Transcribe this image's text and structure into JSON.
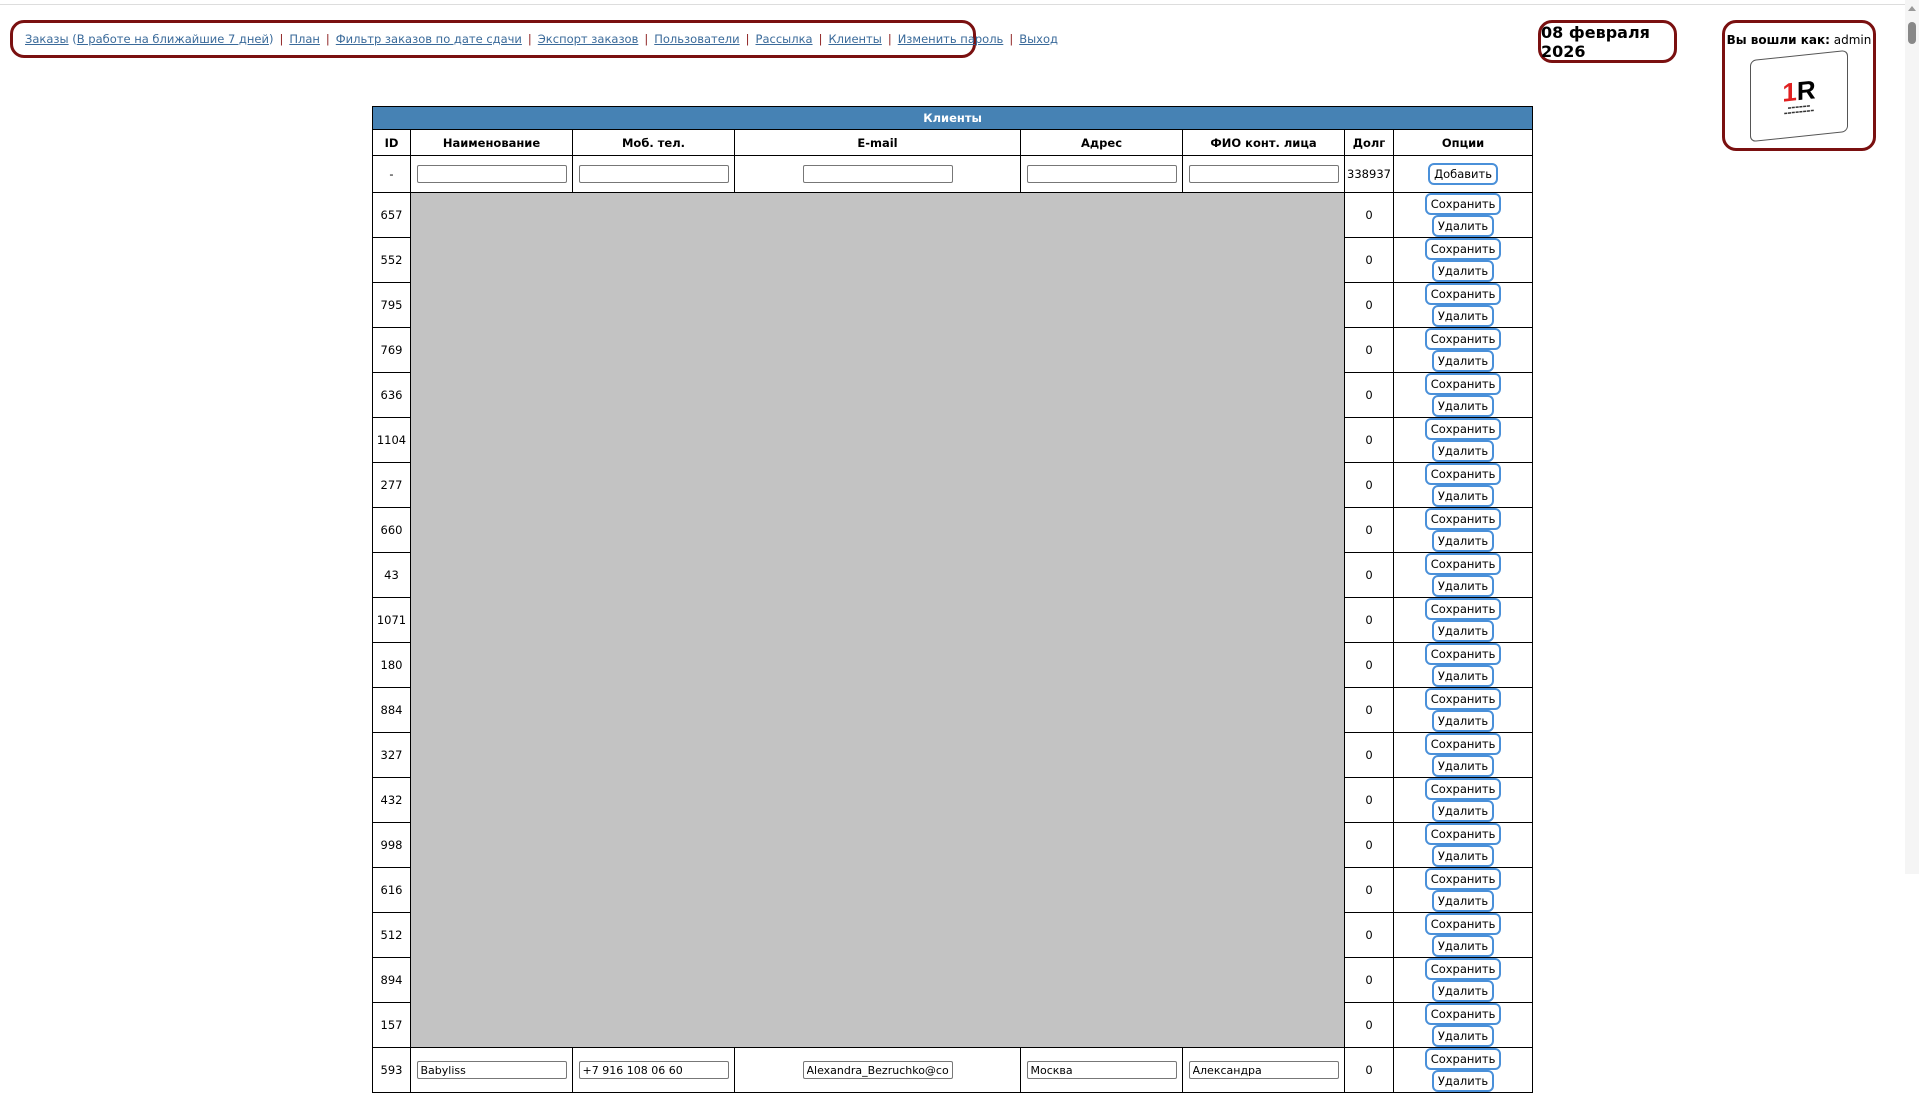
{
  "nav": {
    "items": [
      "Заказы",
      "(",
      "В работе на ближайшие 7 дней",
      ")",
      "План",
      "Фильтр заказов по дате сдачи",
      "Экспорт заказов",
      "Пользователи",
      "Рассылка",
      "Клиенты",
      "Изменить пароль",
      "Выход"
    ]
  },
  "date": "08 февраля 2026",
  "user": {
    "label": "Вы вошли как:",
    "name": "admin",
    "logo_text": "1R"
  },
  "table": {
    "title": "Клиенты",
    "headers": [
      "ID",
      "Наименование",
      "Моб. тел.",
      "E-mail",
      "Адрес",
      "ФИО конт. лица",
      "Долг",
      "Опции"
    ],
    "new_row": {
      "id": "-",
      "debt": "338937",
      "add_label": "Добавить"
    },
    "save_label": "Сохранить",
    "delete_label": "Удалить",
    "rows": [
      {
        "id": "657",
        "debt": "0"
      },
      {
        "id": "552",
        "debt": "0"
      },
      {
        "id": "795",
        "debt": "0"
      },
      {
        "id": "769",
        "debt": "0"
      },
      {
        "id": "636",
        "debt": "0"
      },
      {
        "id": "1104",
        "debt": "0"
      },
      {
        "id": "277",
        "debt": "0"
      },
      {
        "id": "660",
        "debt": "0"
      },
      {
        "id": "43",
        "debt": "0"
      },
      {
        "id": "1071",
        "debt": "0"
      },
      {
        "id": "180",
        "debt": "0"
      },
      {
        "id": "884",
        "debt": "0"
      },
      {
        "id": "327",
        "debt": "0"
      },
      {
        "id": "432",
        "debt": "0"
      },
      {
        "id": "998",
        "debt": "0"
      },
      {
        "id": "616",
        "debt": "0"
      },
      {
        "id": "512",
        "debt": "0"
      },
      {
        "id": "894",
        "debt": "0"
      },
      {
        "id": "157",
        "debt": "0"
      }
    ],
    "last_row": {
      "id": "593",
      "name": "Babyliss",
      "phone": "+7 916 108 06 60",
      "email": "Alexandra_Bezruchko@con",
      "address": "Москва",
      "contact": "Александра",
      "debt": "0"
    }
  }
}
